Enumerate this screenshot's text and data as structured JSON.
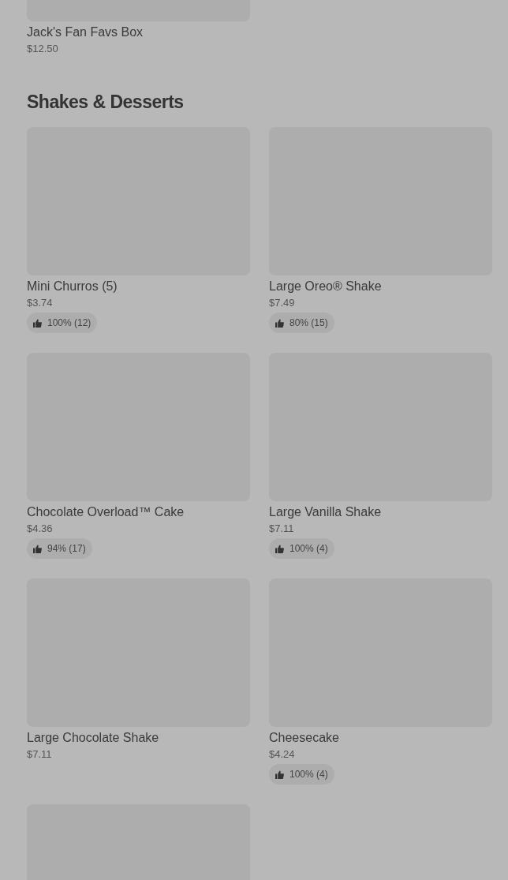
{
  "top_item": {
    "name": "Jack's Fan Favs Box",
    "price": "$12.50"
  },
  "section": {
    "title": "Shakes & Desserts",
    "items": [
      {
        "name": "Mini Churros (5)",
        "price": "$3.74",
        "rating": "100% (12)"
      },
      {
        "name": "Large Oreo® Shake",
        "price": "$7.49",
        "rating": "80% (15)"
      },
      {
        "name": "Chocolate Overload™ Cake",
        "price": "$4.36",
        "rating": "94% (17)"
      },
      {
        "name": "Large Vanilla Shake",
        "price": "$7.11",
        "rating": "100% (4)"
      },
      {
        "name": "Large Chocolate Shake",
        "price": "$7.11"
      },
      {
        "name": "Cheesecake",
        "price": "$4.24",
        "rating": "100% (4)"
      }
    ]
  }
}
